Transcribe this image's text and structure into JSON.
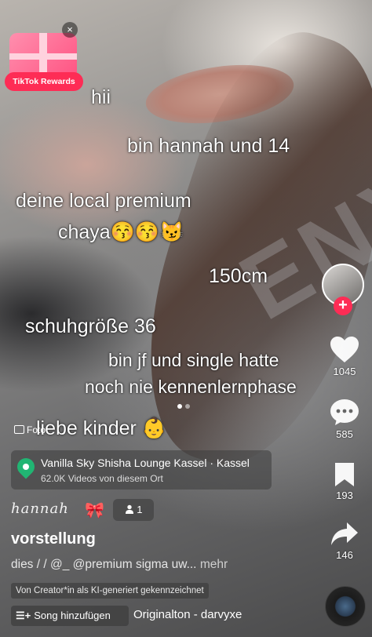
{
  "rewards": {
    "label": "TikTok Rewards",
    "close": "×"
  },
  "overlay_lines": {
    "l1": "hii",
    "l2": "bin hannah und 14",
    "l3": "deine local premium",
    "l4": "chaya😚😚😼",
    "l5": "150cm",
    "l6": "schuhgröße 36",
    "l7": "bin jf und single hatte",
    "l8": "noch nie kennenlernphase",
    "l9": "liebe kinder 👶"
  },
  "actions": {
    "follow": "+",
    "likes": "1045",
    "comments": "585",
    "saves": "193",
    "shares": "146"
  },
  "photo_badge": "Foto",
  "location": {
    "name": "Vanilla Sky Shisha Lounge Kassel · Kassel",
    "sub": "62.0K Videos von diesem Ort"
  },
  "user": {
    "display_name": "hannah",
    "bow": "🎀",
    "friends_count": "1"
  },
  "post": {
    "title": "vorstellung",
    "description": "dies / / @_ @premium sigma uw...",
    "more": "mehr",
    "ai_label": "Von Creator*in als KI-generiert gekennzeichnet"
  },
  "music": {
    "add_song": "Song hinzufügen",
    "sound": "Originalton - darvyxe"
  },
  "icons": {
    "heart": "heart-icon",
    "comment": "comment-icon",
    "bookmark": "bookmark-icon",
    "share": "share-icon"
  },
  "colors": {
    "accent": "#fe2c55",
    "location_pin": "#21b573"
  }
}
